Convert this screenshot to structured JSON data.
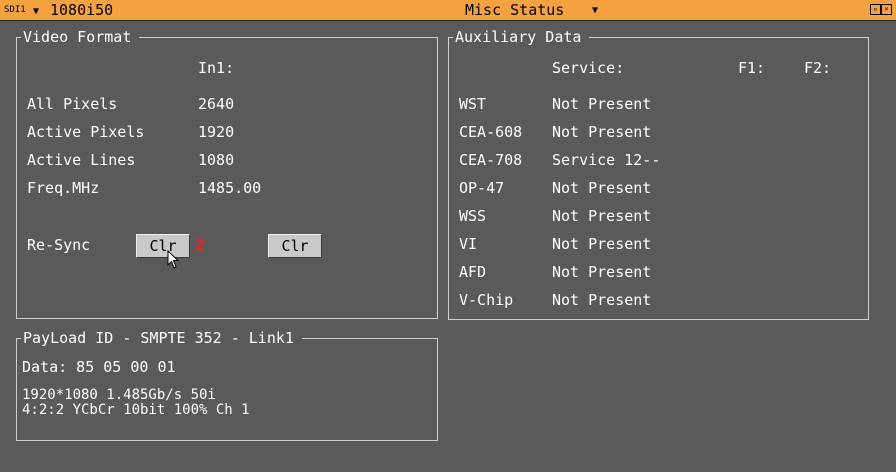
{
  "header": {
    "source": "SDI1",
    "source_arrow": "▼",
    "format": "1080i50",
    "title": "Misc Status",
    "title_arrow": "▼",
    "icons": [
      "restore-icon",
      "close-icon"
    ]
  },
  "video_format": {
    "title": "Video Format",
    "column_header": "In1:",
    "rows": [
      {
        "label": "All Pixels",
        "value": "2640"
      },
      {
        "label": "Active Pixels",
        "value": "1920"
      },
      {
        "label": "Active Lines",
        "value": "1080"
      },
      {
        "label": "Freq.MHz",
        "value": "1485.00"
      }
    ],
    "resync_label": "Re-Sync",
    "clr_button_1": "Clr",
    "clr_count": "2",
    "clr_button_2": "Clr"
  },
  "aux_data": {
    "title": "Auxiliary Data",
    "headers": {
      "service": "Service:",
      "f1": "F1:",
      "f2": "F2:"
    },
    "rows": [
      {
        "name": "WST",
        "service": "Not Present"
      },
      {
        "name": "CEA-608",
        "service": "Not Present"
      },
      {
        "name": "CEA-708",
        "service": "Service 12--"
      },
      {
        "name": "OP-47",
        "service": "Not Present"
      },
      {
        "name": "WSS",
        "service": "Not Present"
      },
      {
        "name": "VI",
        "service": "Not Present"
      },
      {
        "name": "AFD",
        "service": "Not Present"
      },
      {
        "name": "V-Chip",
        "service": "Not Present"
      }
    ]
  },
  "payload": {
    "title": "PayLoad ID - SMPTE 352 - Link1",
    "data_line": "Data: 85 05 00 01",
    "line1": "1920*1080 1.485Gb/s 50i",
    "line2": "4:2:2 YCbCr  10bit 100% Ch 1"
  },
  "colors": {
    "titlebar": "#f3a23f",
    "background": "#5a5a5a",
    "button": "#c9c9c9",
    "alert": "#ff1a1a"
  }
}
